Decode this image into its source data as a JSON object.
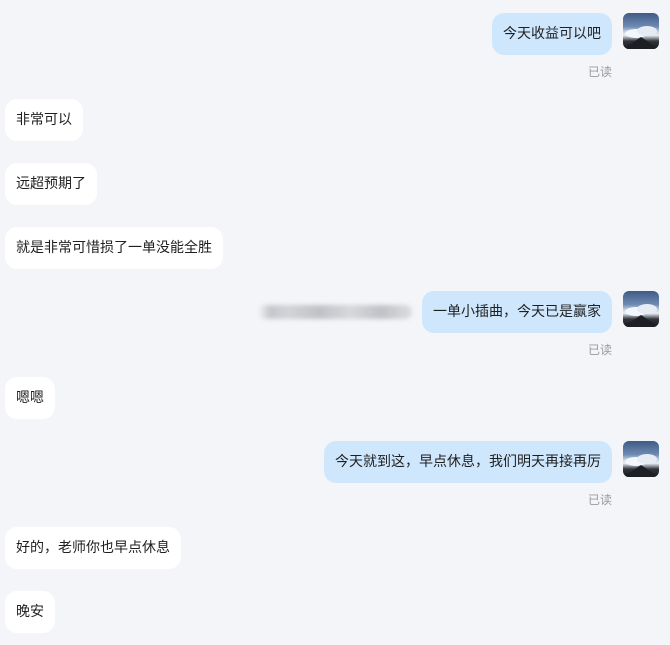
{
  "messages": [
    {
      "side": "right",
      "text": "今天收益可以吧",
      "status": "已读"
    },
    {
      "side": "left",
      "text": "非常可以"
    },
    {
      "side": "left",
      "text": "远超预期了"
    },
    {
      "side": "left",
      "text": "就是非常可惜损了一单没能全胜"
    },
    {
      "side": "right",
      "text": "一单小插曲，今天已是赢家",
      "status": "已读"
    },
    {
      "side": "left",
      "text": "嗯嗯"
    },
    {
      "side": "right",
      "text": "今天就到这，早点休息，我们明天再接再厉",
      "status": "已读"
    },
    {
      "side": "left",
      "text": "好的，老师你也早点休息"
    },
    {
      "side": "left",
      "text": "晚安"
    }
  ],
  "colors": {
    "background": "#f4f5f9",
    "outgoing_bubble": "#cfe7fd",
    "incoming_bubble": "#ffffff",
    "read_status": "#9a9a9a"
  }
}
